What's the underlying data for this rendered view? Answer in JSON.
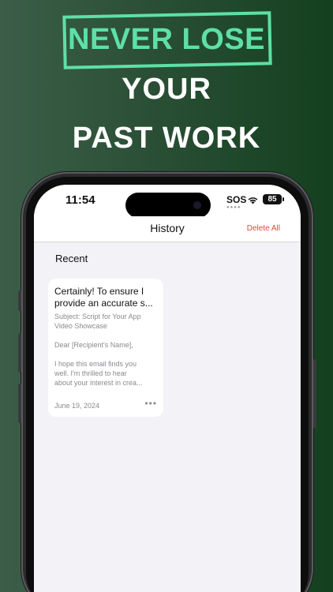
{
  "headline": {
    "line1": "NEVER LOSE",
    "line2": "YOUR",
    "line3": "PAST WORK"
  },
  "status_bar": {
    "time": "11:54",
    "carrier": "SOS",
    "battery": "85"
  },
  "nav": {
    "title": "History",
    "action_label": "Delete All"
  },
  "section": {
    "title": "Recent"
  },
  "cards": [
    {
      "title_line1": "Certainly! To ensure I",
      "title_line2": "provide an accurate s...",
      "body": [
        "Subject: Script for Your App",
        "Video Showcase",
        "",
        "Dear [Recipient's Name],",
        "",
        "I hope this email finds you",
        "well. I'm thrilled to hear",
        "about your interest in crea..."
      ],
      "date": "June 19, 2024",
      "more": "•••"
    }
  ],
  "colors": {
    "accent": "#5de0a6",
    "destructive": "#e0453a",
    "background_left": "#3c5e48",
    "background_right": "#14401f"
  },
  "icons": {
    "wifi": "wifi-icon",
    "battery": "battery-icon",
    "more": "more-horizontal-icon"
  }
}
